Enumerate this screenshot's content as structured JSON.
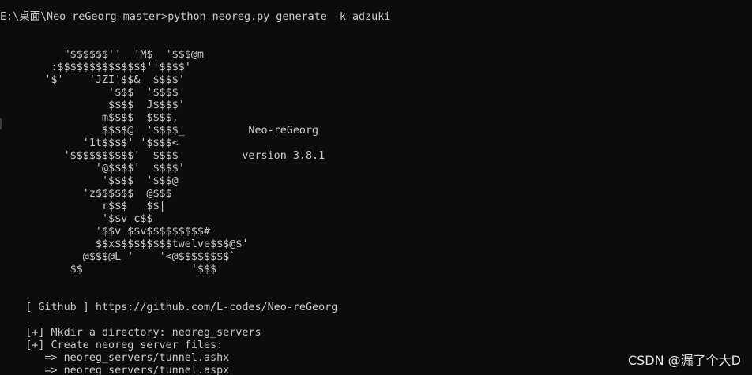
{
  "terminal": {
    "command_line": "E:\\桌面\\Neo-reGeorg-master>python neoreg.py generate -k adzuki",
    "banner": [
      "          \"$$$$$$''  'M$  '$$$@m",
      "        :$$$$$$$$$$$$$$''$$$$'",
      "       '$'    'JZI'$$&  $$$$'",
      "                 '$$$  '$$$$",
      "                 $$$$  J$$$$'",
      "                m$$$$  $$$$,",
      "                $$$$@  '$$$$_          Neo-reGeorg",
      "             '1t$$$$' '$$$$<",
      "          '$$$$$$$$$$'  $$$$          version 3.8.1",
      "               '@$$$$'  $$$$'",
      "                '$$$$  '$$$@",
      "             'z$$$$$$  @$$$",
      "                r$$$   $$|",
      "                '$$v c$$",
      "               '$$v $$v$$$$$$$$$#",
      "               $$x$$$$$$$$$twelve$$$@$'",
      "             @$$$@L '    '<@$$$$$$$$`",
      "           $$                 '$$$"
    ],
    "github_line": "    [ Github ] https://github.com/L-codes/Neo-reGeorg",
    "output_lines": [
      "    [+] Mkdir a directory: neoreg_servers",
      "    [+] Create neoreg server files:",
      "       => neoreg_servers/tunnel.ashx",
      "       => neoreg_servers/tunnel.aspx"
    ]
  },
  "watermark": "CSDN @漏了个大D"
}
